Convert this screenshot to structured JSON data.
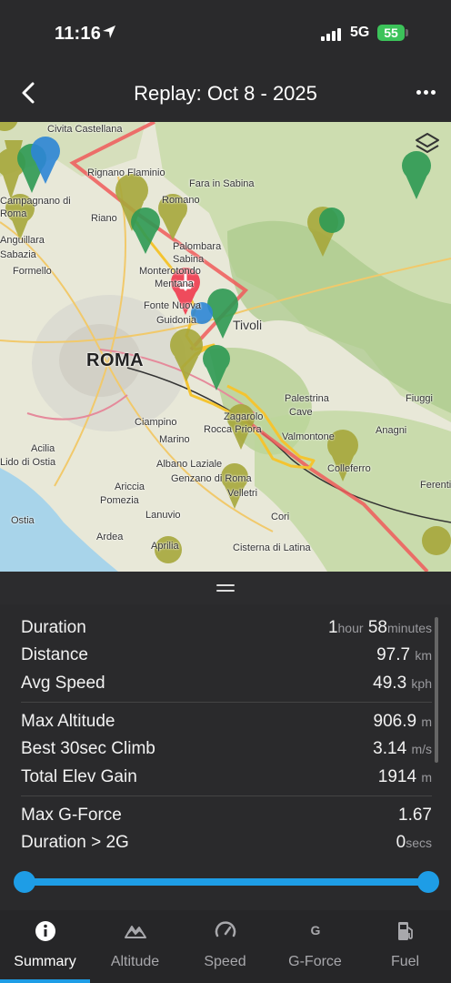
{
  "status": {
    "time": "11:16",
    "network": "5G",
    "battery": "55"
  },
  "nav": {
    "title": "Replay:  Oct 8 - 2025"
  },
  "map": {
    "city_label": "ROMA",
    "place_labels": [
      "Civita Castellana",
      "Rignano Flaminio",
      "Fara in Sabina",
      "Campagnano di Roma",
      "Riano",
      "Romano",
      "Palombara Sabina",
      "Anguillara Sabazia",
      "Formello",
      "Monterotondo",
      "Mentana",
      "Fonte Nuova",
      "Guidonia",
      "Tivoli",
      "Palestrina",
      "Cave",
      "Ciampino",
      "Marino",
      "Zagarolo",
      "Rocca Priora",
      "Valmontone",
      "Fiuggi",
      "Anagni",
      "Acilia",
      "Lido di Ostia",
      "Albano Laziale",
      "Genzano di Roma",
      "Colleferro",
      "Ferentino",
      "Pomezia",
      "Ariccia",
      "Lanuvio",
      "Velletri",
      "Cori",
      "Ardea",
      "Aprilia",
      "Cisterna di Latina",
      "Ostia"
    ]
  },
  "stats": {
    "duration_label": "Duration",
    "duration_hours": "1",
    "duration_hours_unit": "hour",
    "duration_minutes": "58",
    "duration_minutes_unit": "minutes",
    "distance_label": "Distance",
    "distance_value": "97.7",
    "distance_unit": "km",
    "avg_speed_label": "Avg Speed",
    "avg_speed_value": "49.3",
    "avg_speed_unit": "kph",
    "max_alt_label": "Max Altitude",
    "max_alt_value": "906.9",
    "max_alt_unit": "m",
    "climb_label": "Best 30sec Climb",
    "climb_value": "3.14",
    "climb_unit": "m/s",
    "elev_gain_label": "Total Elev Gain",
    "elev_gain_value": "1914",
    "elev_gain_unit": "m",
    "gforce_label": "Max G-Force",
    "gforce_value": "1.67",
    "dur2g_label": "Duration > 2G",
    "dur2g_value": "0",
    "dur2g_unit": "secs"
  },
  "slider": {
    "start_fraction": 0.0,
    "end_fraction": 1.0
  },
  "tabs": [
    {
      "label": "Summary",
      "icon": "info-icon"
    },
    {
      "label": "Altitude",
      "icon": "altitude-icon"
    },
    {
      "label": "Speed",
      "icon": "speedometer-icon"
    },
    {
      "label": "G-Force",
      "icon": "gforce-icon",
      "glyph": "G"
    },
    {
      "label": "Fuel",
      "icon": "fuel-pump-icon"
    }
  ],
  "colors": {
    "accent": "#1e9de6",
    "flight_path": "#f4c430",
    "airspace_boundary": "#f05a5a"
  }
}
